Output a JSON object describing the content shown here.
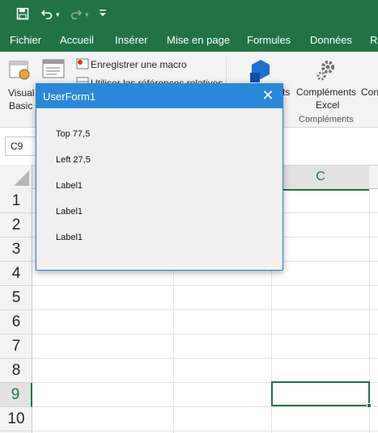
{
  "qat": {
    "save_icon": "save-icon",
    "undo_icon": "undo-icon",
    "redo_icon": "redo-icon",
    "customize_icon": "customize-qat-icon"
  },
  "tabs": [
    "Fichier",
    "Accueil",
    "Insérer",
    "Mise en page",
    "Formules",
    "Données",
    "Ré"
  ],
  "ribbon": {
    "visual_basic_line1": "Visual",
    "visual_basic_line2": "Basic",
    "record_macro": "Enregistrer une macro",
    "relative_refs": "Utiliser les références relatives",
    "addins_partial": "ts",
    "excel_addins_line1": "Compléments",
    "excel_addins_line2": "Excel",
    "com_partial": "Con",
    "group_label": "Compléments"
  },
  "name_box": "C9",
  "grid": {
    "visible_column": "C",
    "rows": [
      "1",
      "2",
      "3",
      "4",
      "5",
      "6",
      "7",
      "8",
      "9",
      "10"
    ],
    "selected_row": "9"
  },
  "dialog": {
    "title": "UserForm1",
    "labels": [
      "Top 77,5",
      "Left 27,5",
      "Label1",
      "Label1",
      "Label1"
    ]
  },
  "colors": {
    "excel_green": "#217346",
    "dialog_title": "#2b88d8"
  }
}
